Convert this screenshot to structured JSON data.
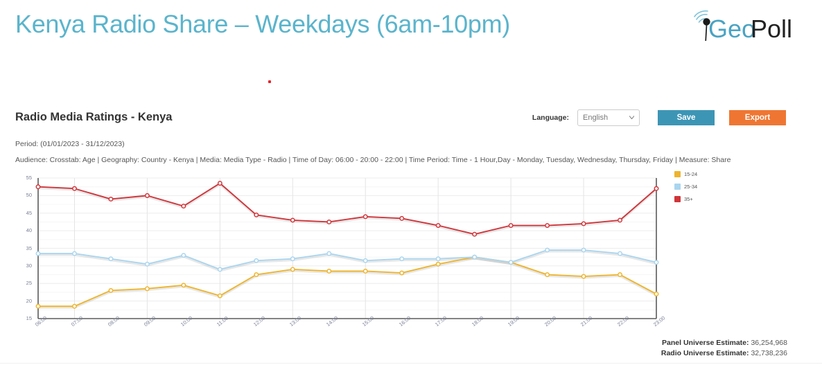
{
  "slide": {
    "title": "Kenya Radio Share – Weekdays (6am-10pm)",
    "accent_color": "#5bb4cc"
  },
  "brand": {
    "name_part1": "Geo",
    "name_part2": "Poll",
    "icon": "antenna-signal-icon",
    "color_primary": "#4aa3c3",
    "color_secondary": "#222222"
  },
  "report": {
    "title": "Radio Media Ratings - Kenya",
    "period": "Period: (01/01/2023 - 31/12/2023)",
    "filters": "Audience: Crosstab: Age | Geography: Country - Kenya | Media: Media Type - Radio | Time of Day: 06:00 - 20:00 - 22:00 | Time Period: Time - 1 Hour,Day - Monday, Tuesday, Wednesday, Thursday, Friday | Measure: Share"
  },
  "toolbar": {
    "language_label": "Language:",
    "language_value": "English",
    "language_options": [
      "English"
    ],
    "save_label": "Save",
    "export_label": "Export",
    "save_color": "#3d95b5",
    "export_color": "#ef7632"
  },
  "estimates": {
    "panel_label": "Panel Universe Estimate:",
    "panel_value": "36,254,968",
    "radio_label": "Radio Universe Estimate:",
    "radio_value": "32,738,236"
  },
  "chart_data": {
    "type": "line",
    "title": "",
    "xlabel": "",
    "ylabel": "",
    "grid": true,
    "legend_position": "right",
    "ylim": [
      15,
      55
    ],
    "yticks": [
      55,
      50,
      45,
      40,
      35,
      30,
      25,
      20,
      15
    ],
    "categories": [
      "06:00",
      "07:00",
      "08:00",
      "09:00",
      "10:00",
      "11:00",
      "12:00",
      "13:00",
      "14:00",
      "15:00",
      "16:00",
      "17:00",
      "18:00",
      "19:00",
      "20:00",
      "21:00",
      "22:00",
      "23:00"
    ],
    "series": [
      {
        "name": "15-24",
        "color": "#eeb42c",
        "values": [
          18.5,
          18.5,
          23.0,
          23.5,
          24.5,
          21.5,
          27.5,
          29.0,
          28.5,
          28.5,
          28.0,
          30.5,
          32.5,
          31.0,
          27.5,
          27.0,
          27.5,
          22.0
        ]
      },
      {
        "name": "25-34",
        "color": "#a9d5ef",
        "values": [
          33.5,
          33.5,
          32.0,
          30.5,
          33.0,
          29.0,
          31.5,
          32.0,
          33.5,
          31.5,
          32.0,
          32.0,
          32.5,
          31.0,
          34.5,
          34.5,
          33.5,
          31.0
        ]
      },
      {
        "name": "35+",
        "color": "#d0353a",
        "values": [
          52.5,
          52.0,
          49.0,
          50.0,
          47.0,
          53.5,
          44.5,
          43.0,
          42.5,
          44.0,
          43.5,
          41.5,
          39.0,
          41.5,
          41.5,
          42.0,
          43.0,
          52.0
        ]
      }
    ]
  }
}
